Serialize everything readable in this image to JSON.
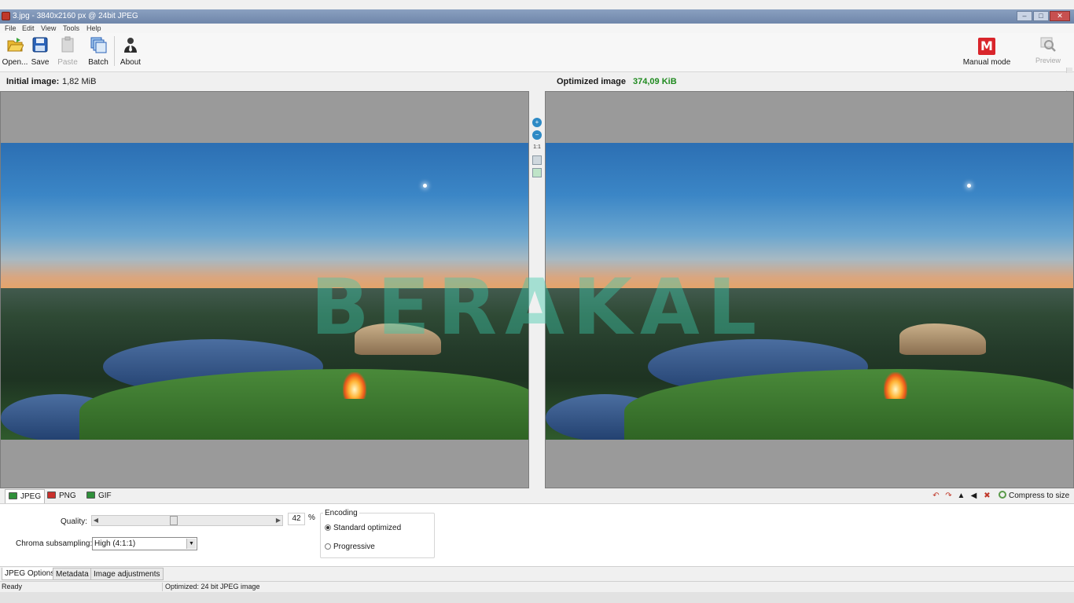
{
  "window": {
    "title": "3.jpg - 3840x2160 px @ 24bit JPEG",
    "controls": [
      "–",
      "□",
      "✕"
    ]
  },
  "menu": [
    "File",
    "Edit",
    "View",
    "Tools",
    "Help"
  ],
  "toolbar": {
    "open": "Open...",
    "save": "Save",
    "paste": "Paste",
    "batch": "Batch",
    "about": "About",
    "mode": "Manual mode",
    "preview": "Preview"
  },
  "info": {
    "initial_label": "Initial image:",
    "initial_size": "1,82 MiB",
    "optimized_label": "Optimized image",
    "optimized_size": "374,09 KiB"
  },
  "watermark": "BERAKAL",
  "zoom": {
    "actual_size": "1:1"
  },
  "format_tabs": [
    "JPEG",
    "PNG",
    "GIF"
  ],
  "compress_to_size": "Compress to size",
  "jpeg_options": {
    "quality_label": "Quality:",
    "quality_value": "42",
    "quality_unit": "%",
    "chroma_label": "Chroma subsampling:",
    "chroma_value": "High (4:1:1)",
    "encoding_title": "Encoding",
    "encoding_options": [
      "Standard optimized",
      "Progressive"
    ],
    "encoding_selected": "Standard optimized"
  },
  "bottom_tabs": [
    "JPEG Options",
    "Metadata",
    "Image adjustments"
  ],
  "status": {
    "left": "Ready",
    "right": "Optimized: 24 bit JPEG image"
  },
  "colors": {
    "optimized_size": "#1f8a1f",
    "manual_mode": "#d9252b"
  }
}
